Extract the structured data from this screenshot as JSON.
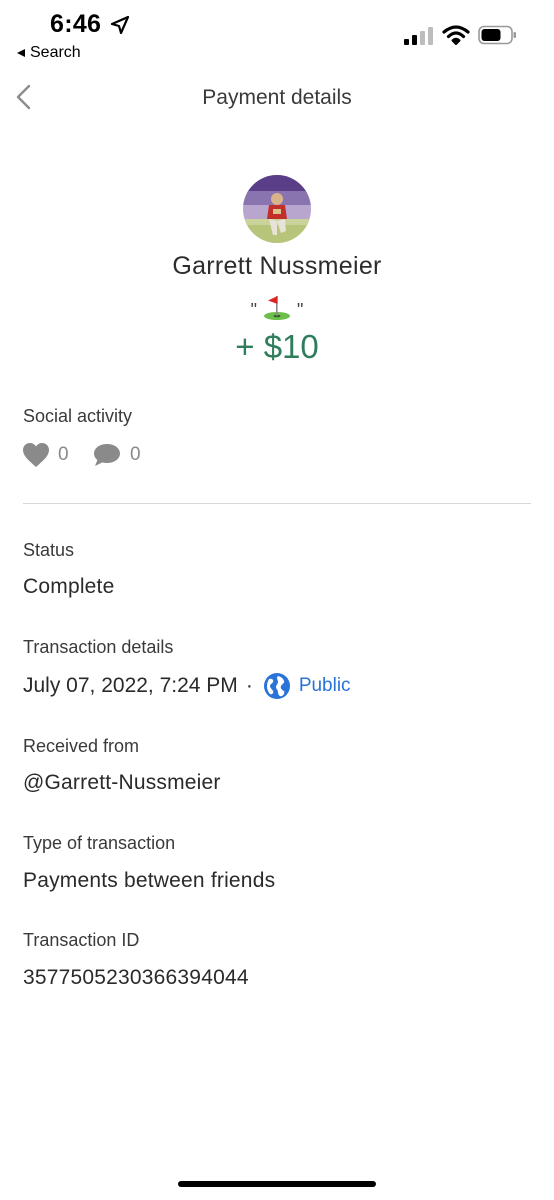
{
  "status_bar": {
    "time": "6:46",
    "back_app_label": "Search"
  },
  "nav": {
    "title": "Payment details"
  },
  "transaction": {
    "sender_name": "Garrett Nussmeier",
    "note_open_quote": "\"",
    "note_close_quote": "\"",
    "note_emoji": "flag-in-hole-icon",
    "amount": "+ $10"
  },
  "social": {
    "label": "Social activity",
    "likes": "0",
    "comments": "0"
  },
  "details": {
    "status_label": "Status",
    "status_value": "Complete",
    "tx_details_label": "Transaction details",
    "tx_date": "July 07, 2022, 7:24 PM",
    "tx_separator": "·",
    "privacy": "Public",
    "received_from_label": "Received from",
    "received_from_value": "@Garrett-Nussmeier",
    "type_label": "Type of transaction",
    "type_value": "Payments between friends",
    "id_label": "Transaction ID",
    "id_value": "3577505230366394044"
  },
  "colors": {
    "amount_green": "#2f7d5a",
    "link_blue": "#2a73d9",
    "muted_gray": "#8a8a8a"
  }
}
